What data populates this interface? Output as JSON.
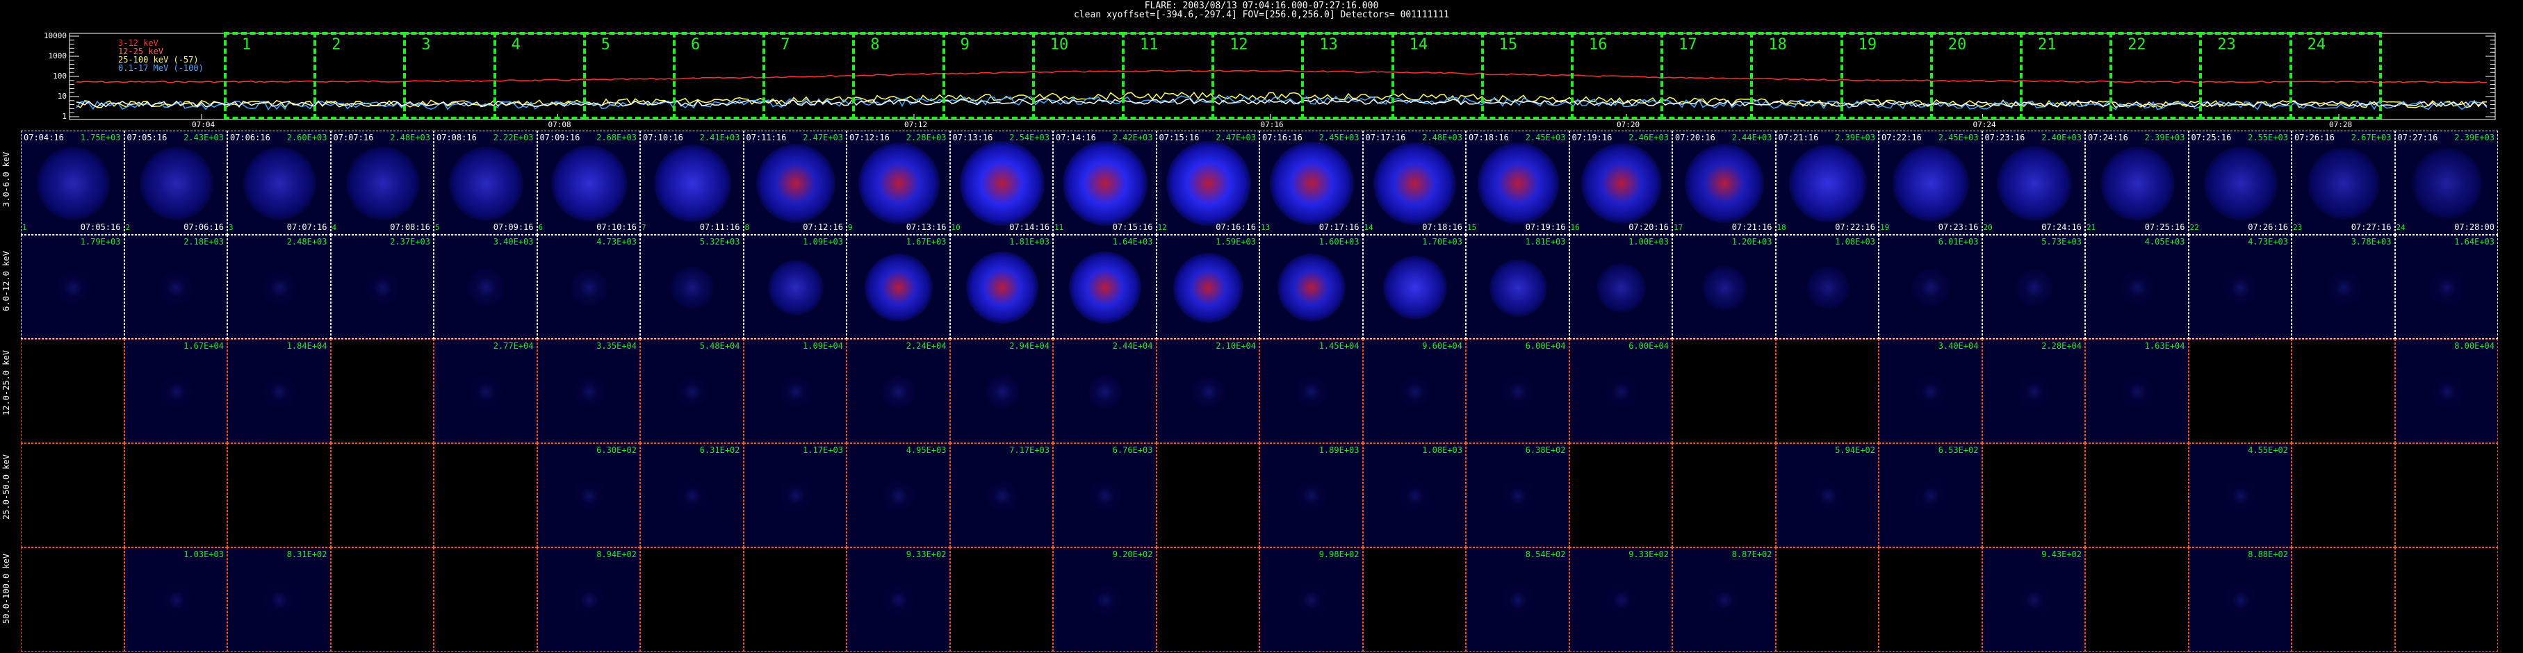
{
  "header": {
    "title": "FLARE: 2003/08/13 07:04:16.000-07:27:16.000",
    "subtitle": "clean    xyoffset=[-394.6,-297.4]   FOV=[256.0,256.0]    Detectors= 001111111"
  },
  "lightcurve": {
    "y_ticks": [
      "10000",
      "1000",
      "100",
      "10",
      "1"
    ],
    "legend": [
      {
        "label": "3-12 keV",
        "color": "#ff3030"
      },
      {
        "label": "12-25 keV",
        "color": "#ff6060"
      },
      {
        "label": "25-100 keV (-57)",
        "color": "#ffff66"
      },
      {
        "label": "0.1-17 MeV (-100)",
        "color": "#4aa8ff"
      }
    ],
    "time_ticks": [
      "07:04",
      "07:08",
      "07:12",
      "07:16",
      "07:20",
      "07:24",
      "07:28"
    ],
    "segments": [
      "1",
      "2",
      "3",
      "4",
      "5",
      "6",
      "7",
      "8",
      "9",
      "10",
      "11",
      "12",
      "13",
      "14",
      "15",
      "16",
      "17",
      "18",
      "19",
      "20",
      "21",
      "22",
      "23",
      "24"
    ]
  },
  "colors": {
    "segment_box": "#22ee22",
    "value_text": "#22ee22",
    "row_border_white": "#ffffff",
    "row_border_red": "#ff5522",
    "cell_bg": "#000030"
  },
  "rows": [
    {
      "label": "3.0-6.0 keV",
      "border": "white"
    },
    {
      "label": "6.0-12.0 keV",
      "border": "white"
    },
    {
      "label": "12.0-25.0 keV",
      "border": "red"
    },
    {
      "label": "25.0-50.0 keV",
      "border": "red"
    },
    {
      "label": "50.0-100.0 keV",
      "border": "red"
    }
  ],
  "start_times": [
    "07:04:16",
    "07:05:16",
    "07:06:16",
    "07:07:16",
    "07:08:16",
    "07:09:16",
    "07:10:16",
    "07:11:16",
    "07:12:16",
    "07:13:16",
    "07:14:16",
    "07:15:16",
    "07:16:16",
    "07:17:16",
    "07:18:16",
    "07:19:16",
    "07:20:16",
    "07:21:16",
    "07:22:16",
    "07:23:16",
    "07:24:16",
    "07:25:16",
    "07:26:16",
    "07:27:16"
  ],
  "end_times": [
    "07:05:16",
    "07:06:16",
    "07:07:16",
    "07:08:16",
    "07:09:16",
    "07:10:16",
    "07:11:16",
    "07:12:16",
    "07:13:16",
    "07:14:16",
    "07:15:16",
    "07:16:16",
    "07:17:16",
    "07:18:16",
    "07:19:16",
    "07:20:16",
    "07:21:16",
    "07:22:16",
    "07:23:16",
    "07:24:16",
    "07:25:16",
    "07:26:16",
    "07:27:16",
    "07:28:00"
  ],
  "values": [
    [
      "1.75E+03",
      "2.43E+03",
      "2.60E+03",
      "2.48E+03",
      "2.22E+03",
      "2.68E+03",
      "2.41E+03",
      "2.47E+03",
      "2.28E+03",
      "2.54E+03",
      "2.42E+03",
      "2.47E+03",
      "2.45E+03",
      "2.48E+03",
      "2.45E+03",
      "2.46E+03",
      "2.44E+03",
      "2.39E+03",
      "2.45E+03",
      "2.40E+03",
      "2.39E+03",
      "2.55E+03",
      "2.67E+03",
      "2.39E+03"
    ],
    [
      "1.79E+03",
      "2.18E+03",
      "2.48E+03",
      "2.37E+03",
      "3.40E+03",
      "4.73E+03",
      "5.32E+03",
      "1.09E+03",
      "1.67E+03",
      "1.81E+03",
      "1.64E+03",
      "1.59E+03",
      "1.60E+03",
      "1.70E+03",
      "1.81E+03",
      "1.00E+03",
      "1.20E+03",
      "1.08E+03",
      "6.01E+03",
      "5.73E+03",
      "4.05E+03",
      "4.73E+03",
      "3.78E+03",
      "1.64E+03"
    ],
    [
      "",
      "1.67E+04",
      "1.84E+04",
      "",
      "2.77E+04",
      "3.35E+04",
      "5.48E+04",
      "1.09E+04",
      "2.24E+04",
      "2.94E+04",
      "2.44E+04",
      "2.10E+04",
      "1.45E+04",
      "9.60E+04",
      "6.00E+04",
      "6.00E+04",
      "",
      "",
      "3.40E+04",
      "2.28E+04",
      "1.63E+04",
      "",
      "",
      "8.00E+04"
    ],
    [
      "",
      "",
      "",
      "",
      "",
      "6.30E+02",
      "6.31E+02",
      "1.17E+03",
      "4.95E+03",
      "7.17E+03",
      "6.76E+03",
      "",
      "1.89E+03",
      "1.08E+03",
      "6.38E+02",
      "",
      "",
      "5.94E+02",
      "6.53E+02",
      "",
      "",
      "4.55E+02",
      "",
      ""
    ],
    [
      "",
      "1.03E+03",
      "8.31E+02",
      "",
      "",
      "8.94E+02",
      "",
      "",
      "9.33E+02",
      "",
      "9.20E+02",
      "",
      "9.98E+02",
      "",
      "8.54E+02",
      "9.33E+02",
      "8.87E+02",
      "",
      "",
      "9.43E+02",
      "",
      "8.88E+02",
      "",
      ""
    ]
  ],
  "intensity": [
    [
      0.45,
      0.45,
      0.45,
      0.45,
      0.5,
      0.6,
      0.65,
      0.75,
      0.85,
      1.0,
      1.0,
      1.0,
      0.95,
      0.9,
      0.85,
      0.8,
      0.72,
      0.65,
      0.6,
      0.55,
      0.5,
      0.45,
      0.4,
      0.35
    ],
    [
      0.05,
      0.05,
      0.05,
      0.05,
      0.1,
      0.1,
      0.2,
      0.5,
      0.8,
      0.9,
      0.9,
      0.85,
      0.8,
      0.7,
      0.55,
      0.35,
      0.25,
      0.2,
      0.1,
      0.1,
      0.05,
      0.05,
      0.05,
      0.05
    ],
    [
      0,
      0.04,
      0.04,
      0,
      0.04,
      0.05,
      0.05,
      0.06,
      0.1,
      0.12,
      0.12,
      0.08,
      0.06,
      0.05,
      0.04,
      0.04,
      0,
      0,
      0.04,
      0.04,
      0.04,
      0,
      0,
      0.04
    ],
    [
      0,
      0,
      0,
      0,
      0,
      0.03,
      0.03,
      0.04,
      0.06,
      0.06,
      0.05,
      0,
      0.04,
      0.03,
      0.03,
      0,
      0,
      0.03,
      0.03,
      0,
      0,
      0.03,
      0,
      0
    ],
    [
      0,
      0.03,
      0.03,
      0,
      0,
      0.03,
      0,
      0,
      0.04,
      0,
      0.04,
      0,
      0.03,
      0,
      0.03,
      0.03,
      0.03,
      0,
      0,
      0.03,
      0,
      0.03,
      0,
      0
    ]
  ]
}
